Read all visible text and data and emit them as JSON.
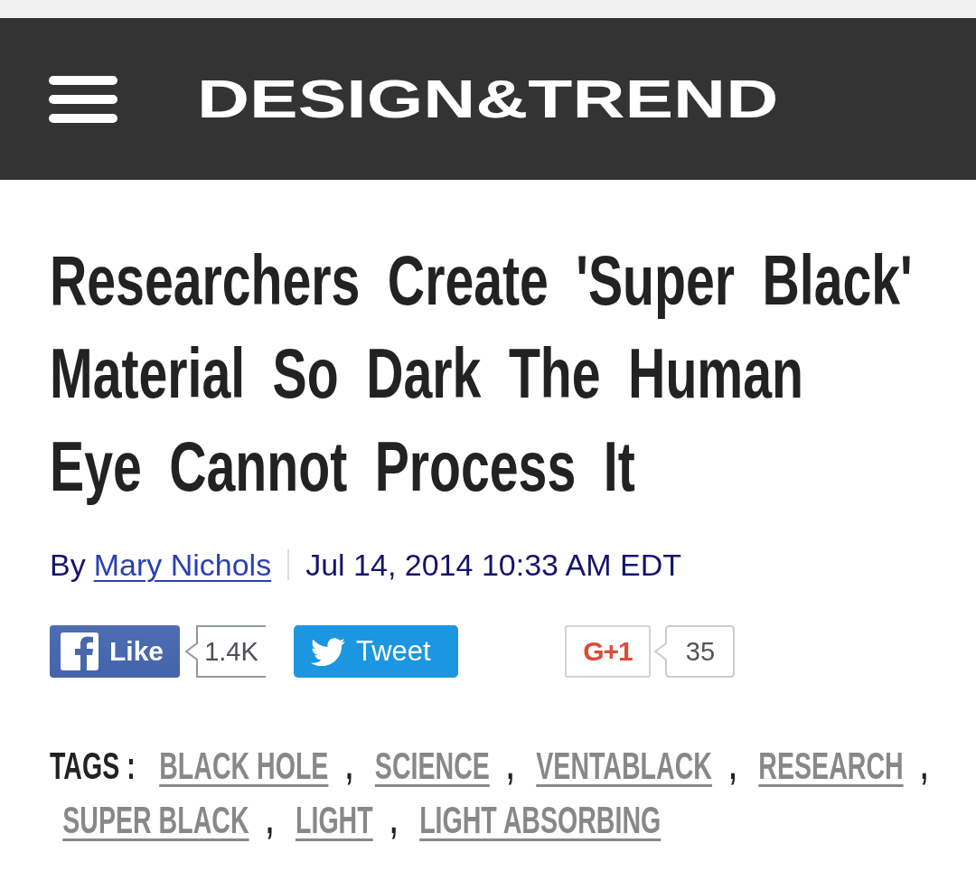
{
  "header": {
    "logo": "DESIGN&TREND"
  },
  "article": {
    "title": "Researchers Create 'Super Black' Material So Dark The Human Eye Cannot Process It",
    "byline": {
      "prefix": "By",
      "author": "Mary Nichols",
      "date": "Jul 14, 2014 10:33 AM EDT"
    }
  },
  "social": [
    {
      "kind": "facebook",
      "label": "Like",
      "count": "1.4K"
    },
    {
      "kind": "twitter",
      "label": "Tweet"
    },
    {
      "kind": "google",
      "label": "G+1",
      "count": "35"
    }
  ],
  "tags": {
    "label": "TAGS :",
    "items": [
      {
        "label": "BLACK HOLE",
        "separator": ","
      },
      {
        "label": "SCIENCE",
        "separator": ","
      },
      {
        "label": "VENTABLACK",
        "separator": ","
      },
      {
        "label": "RESEARCH",
        "separator": ","
      },
      {
        "label": "SUPER BLACK",
        "separator": ","
      },
      {
        "label": "LIGHT",
        "separator": ","
      },
      {
        "label": "LIGHT ABSORBING"
      }
    ]
  }
}
